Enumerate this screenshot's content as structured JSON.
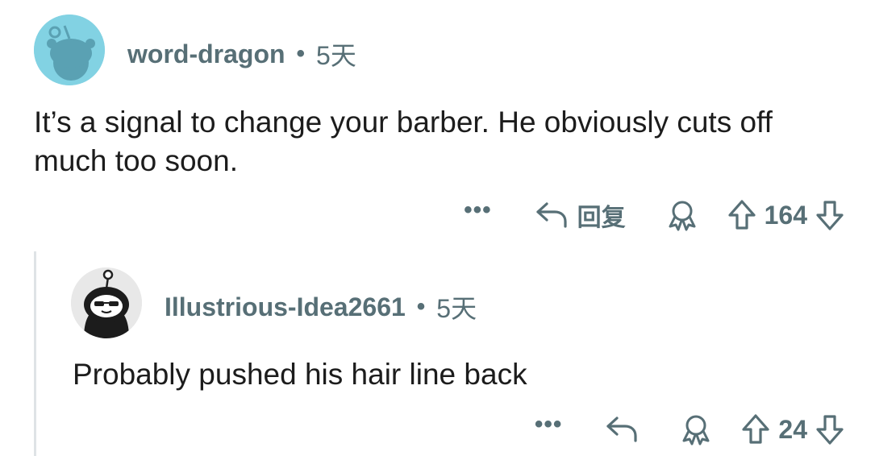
{
  "comments": [
    {
      "author": "word-dragon",
      "separator": "•",
      "age": "5天",
      "body": "It’s a signal to change your barber.  He obviously cuts off much too soon.",
      "actions": {
        "more": "•••",
        "reply_label": "回复",
        "score": "164"
      }
    },
    {
      "author": "Illustrious-Idea2661",
      "separator": "•",
      "age": "5天",
      "body": "Probably pushed his hair line back",
      "actions": {
        "more": "•••",
        "score": "24"
      }
    }
  ],
  "icons": {
    "avatar1": "snoo-avatar-icon",
    "avatar2": "snoo-sunglasses-avatar-icon",
    "reply": "reply-arrow-icon",
    "award": "award-icon",
    "upvote": "upvote-arrow-icon",
    "downvote": "downvote-arrow-icon"
  },
  "colors": {
    "meta": "#576f76",
    "text": "#1c1c1c",
    "avatar1_bg": "#82d2e3",
    "thread_line": "#dfe3e6"
  }
}
